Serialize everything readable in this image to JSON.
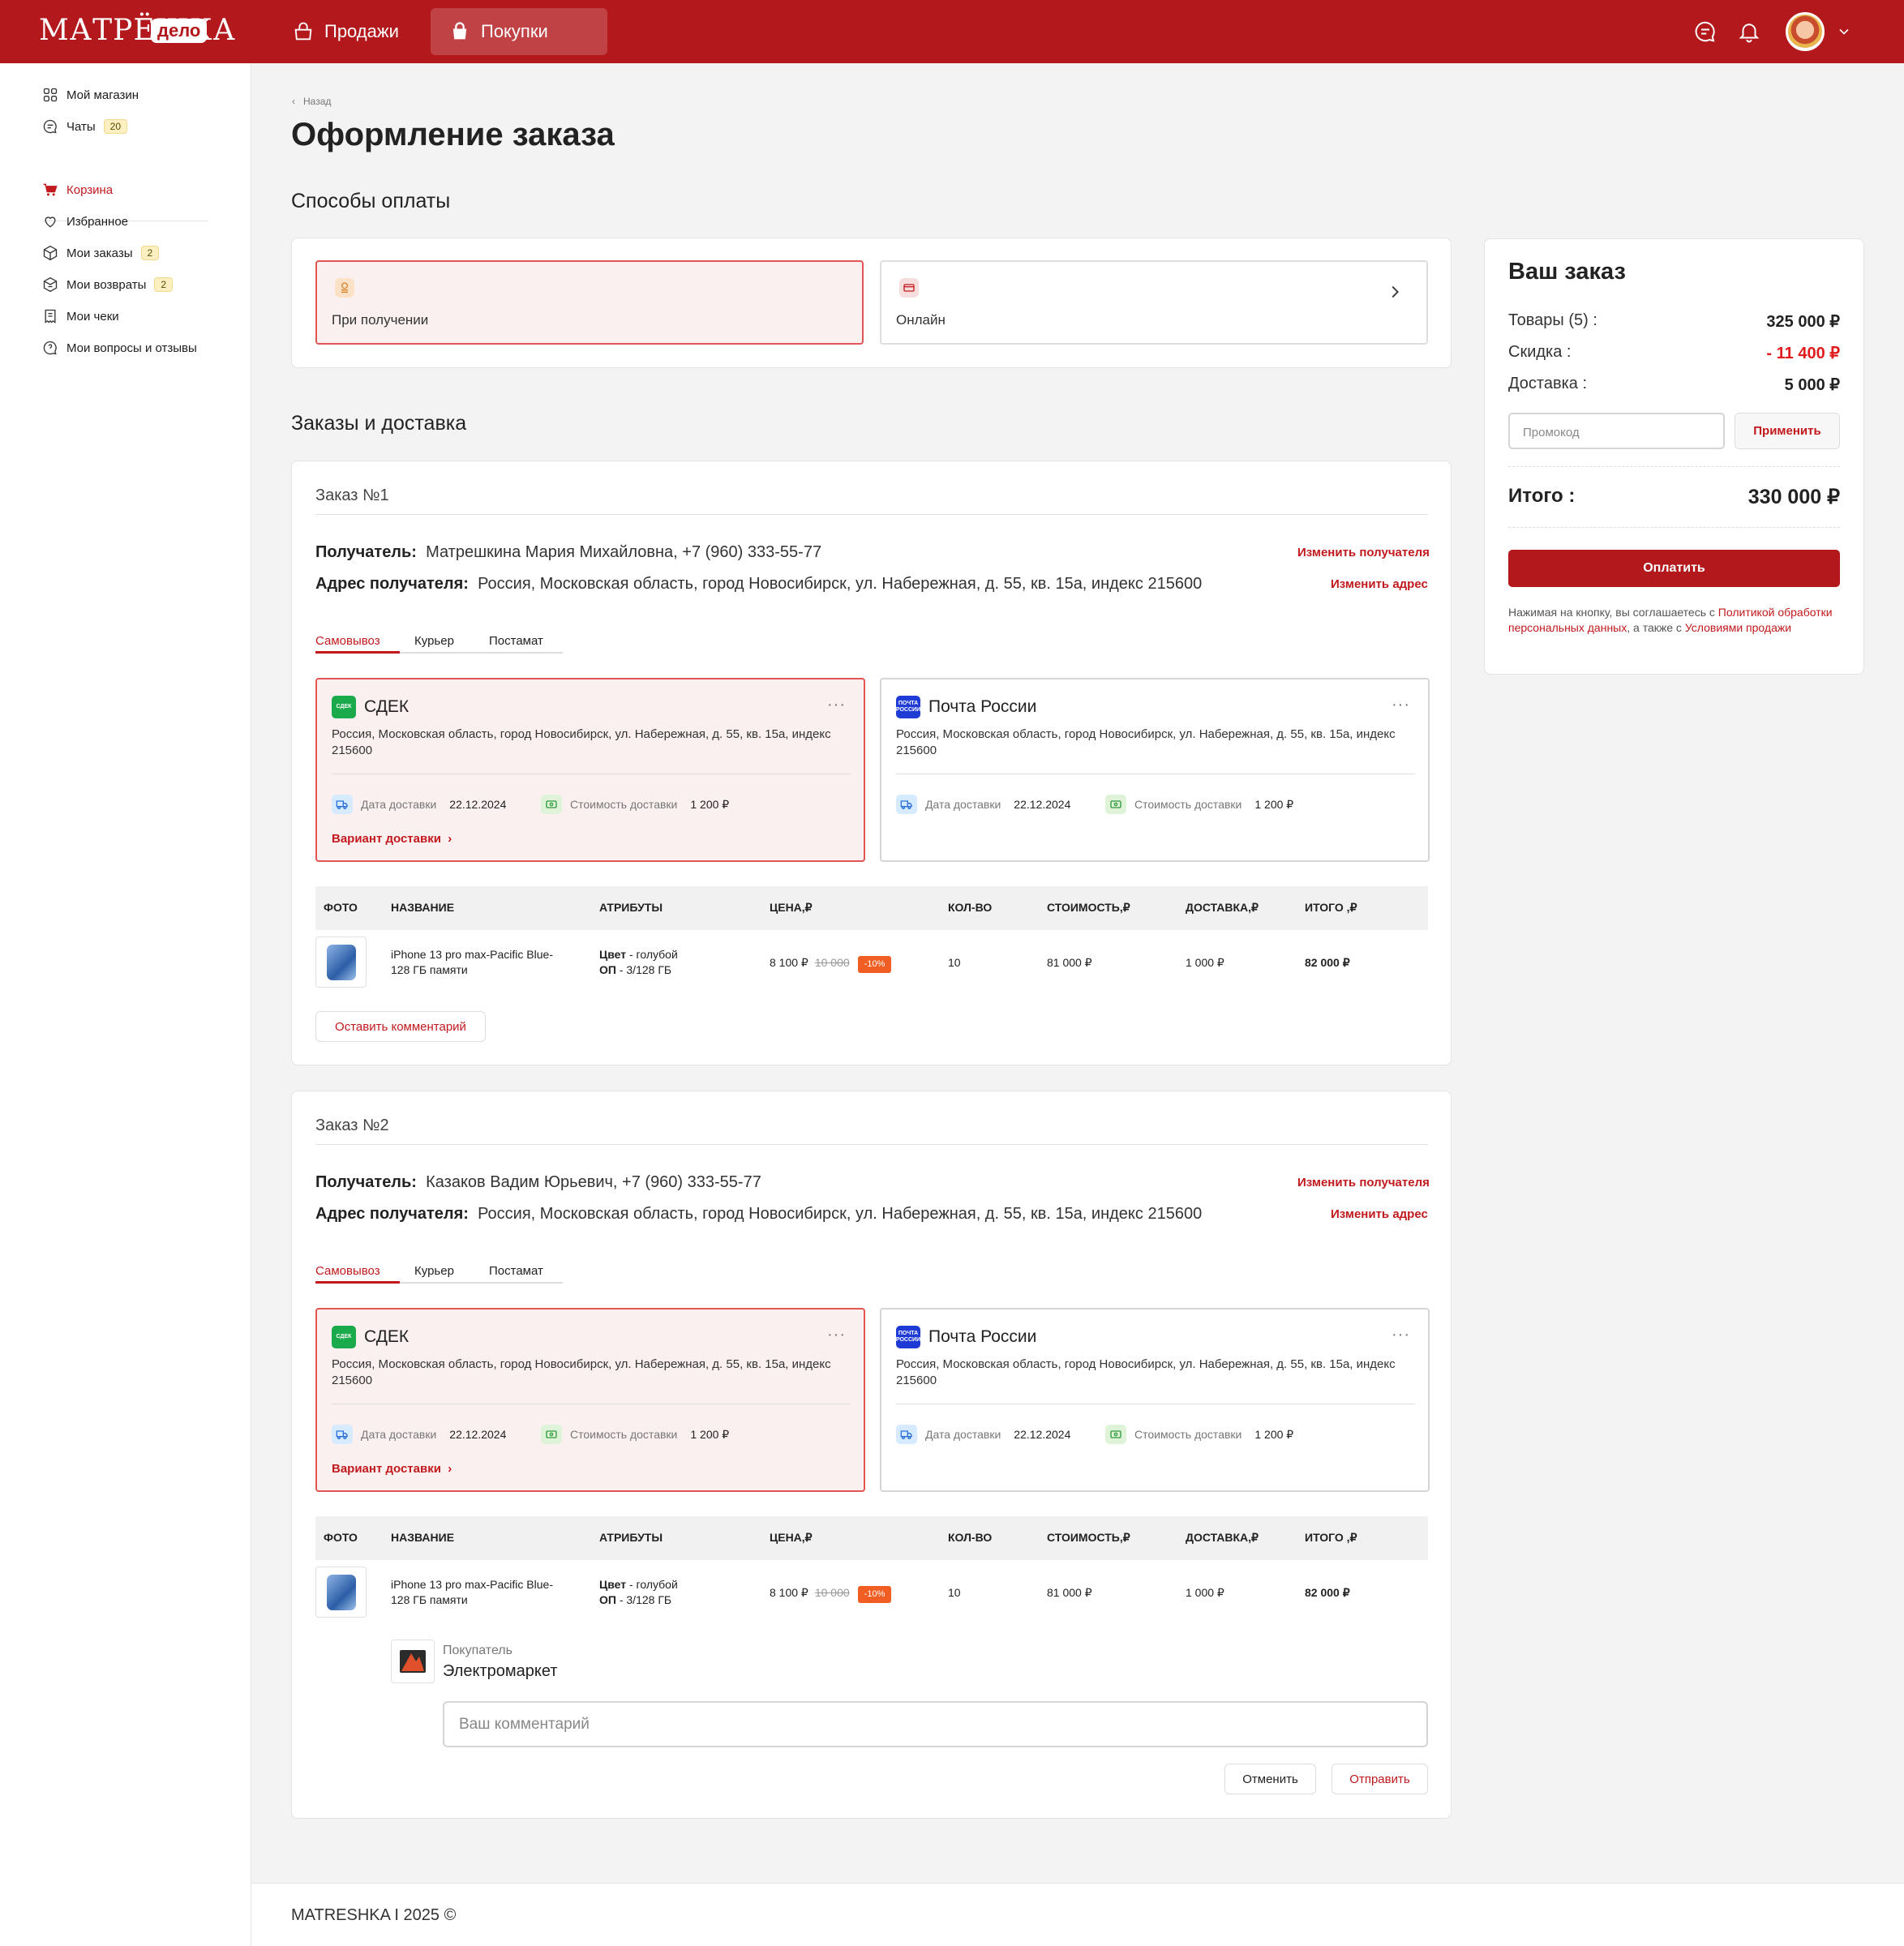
{
  "header": {
    "logo_text": "МАТРЁШКА",
    "logo_badge": "дело",
    "tabs": [
      {
        "label": "Продажи"
      },
      {
        "label": "Покупки"
      }
    ]
  },
  "sidebar": {
    "items": [
      {
        "label": "Мой магазин",
        "badge": ""
      },
      {
        "label": "Чаты",
        "badge": "20"
      },
      {
        "label": "Корзина",
        "badge": ""
      },
      {
        "label": "Избранное",
        "badge": ""
      },
      {
        "label": "Мои заказы",
        "badge": "2"
      },
      {
        "label": "Мои возвраты",
        "badge": "2"
      },
      {
        "label": "Мои чеки",
        "badge": ""
      },
      {
        "label": "Мои вопросы и отзывы",
        "badge": ""
      }
    ]
  },
  "page": {
    "back": "Назад",
    "title": "Оформление заказа",
    "payment_title": "Способы оплаты",
    "payment_options": [
      {
        "label": "При получении"
      },
      {
        "label": "Онлайн"
      }
    ],
    "orders_title": "Заказы и доставка"
  },
  "labels": {
    "recipient": "Получатель:",
    "address": "Адрес получателя:",
    "change_recipient": "Изменить получателя",
    "change_address": "Изменить адрес",
    "tabs": [
      "Самовывоз",
      "Курьер",
      "Постамат"
    ],
    "delivery_date": "Дата доставки",
    "delivery_cost": "Стоимость доставки",
    "delivery_variant": "Вариант доставки",
    "columns": [
      "ФОТО",
      "НАЗВАНИЕ",
      "АТРИБУТЫ",
      "ЦЕНА,₽",
      "КОЛ-ВО",
      "СТОИМОСТЬ,₽",
      "ДОСТАВКА,₽",
      "ИТОГО ,₽"
    ],
    "attr_color": "Цвет",
    "attr_memory": "ОП",
    "leave_comment": "Оставить комментарий"
  },
  "orders": [
    {
      "title": "Заказ №1",
      "recipient": "Матрешкина Мария Михайловна,  +7 (960) 333-55-77",
      "address": "Россия, Московская область, город  Новосибирск, ул. Набережная, д. 55, кв. 15а, индекс 215600",
      "providers": [
        {
          "logo": "СДЕК",
          "name": "СДЕК",
          "address": "Россия, Московская область, город  Новосибирск, ул. Набережная, д. 55, кв. 15а, индекс 215600",
          "date": "22.12.2024",
          "cost": "1 200 ₽"
        },
        {
          "logo": "ПОЧТА РОССИИ",
          "name": "Почта России",
          "address": "Россия, Московская область, город  Новосибирск, ул. Набережная, д. 55, кв. 15а, индекс 215600",
          "date": "22.12.2024",
          "cost": "1 200 ₽"
        }
      ],
      "item": {
        "name": "iPhone 13 pro max-Pacific Blue-128 ГБ памяти",
        "color": " - голубой",
        "memory": " - 3/128 ГБ",
        "price": "8 100 ₽",
        "old_price": "10 000",
        "discount": "-10%",
        "qty": "10",
        "cost": "81 000 ₽",
        "delivery": "1 000 ₽",
        "total": "82 000 ₽"
      }
    },
    {
      "title": "Заказ №2",
      "recipient": "Казаков Вадим Юрьевич,  +7 (960) 333-55-77",
      "address": "Россия, Московская область, город  Новосибирск, ул. Набережная, д. 55, кв. 15а, индекс 215600",
      "providers": [
        {
          "logo": "СДЕК",
          "name": "СДЕК",
          "address": "Россия, Московская область, город  Новосибирск, ул. Набережная, д. 55, кв. 15а, индекс 215600",
          "date": "22.12.2024",
          "cost": "1 200 ₽"
        },
        {
          "logo": "ПОЧТА РОССИИ",
          "name": "Почта России",
          "address": "Россия, Московская область, город  Новосибирск, ул. Набережная, д. 55, кв. 15а, индекс 215600",
          "date": "22.12.2024",
          "cost": "1 200 ₽"
        }
      ],
      "item": {
        "name": "iPhone 13 pro max-Pacific Blue-128 ГБ памяти",
        "color": " - голубой",
        "memory": " - 3/128 ГБ",
        "price": "8 100 ₽",
        "old_price": "10 000",
        "discount": "-10%",
        "qty": "10",
        "cost": "81 000 ₽",
        "delivery": "1 000 ₽",
        "total": "82 000 ₽"
      },
      "comment": {
        "role": "Покупатель",
        "shop": "Электромаркет",
        "placeholder": "Ваш комментарий",
        "cancel": "Отменить",
        "send": "Отправить"
      }
    }
  ],
  "summary": {
    "title": "Ваш заказ",
    "goods_label": "Товары (5) :",
    "goods_value": "325 000 ₽",
    "discount_label": "Скидка :",
    "discount_value": "- 11 400 ₽",
    "delivery_label": "Доставка :",
    "delivery_value": "5 000 ₽",
    "promo_placeholder": "Промокод",
    "apply": "Применить",
    "total_label": "Итого :",
    "total_value": "330 000 ₽",
    "pay": "Оплатить",
    "legal_1": "Нажимая на кнопку, вы соглашаетесь с ",
    "legal_link_1": "Политикой обработки персональных данных",
    "legal_2": ", а также с ",
    "legal_link_2": "Условиями продажи"
  },
  "footer": {
    "text": "MATRESHKA I 2025 ©"
  },
  "colors": {
    "brand": "#b3191c",
    "accent": "#c1191d",
    "selected_bg": "#fbf0f0",
    "discount": "#f05e23"
  }
}
